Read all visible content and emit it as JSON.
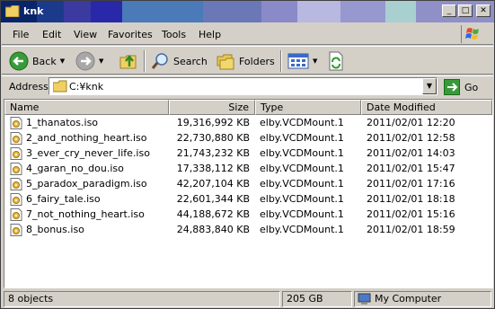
{
  "window": {
    "title": "knk"
  },
  "menu": [
    "File",
    "Edit",
    "View",
    "Favorites",
    "Tools",
    "Help"
  ],
  "toolbar": {
    "back": "Back",
    "search": "Search",
    "folders": "Folders"
  },
  "address": {
    "label": "Address",
    "value": "C:¥knk",
    "go": "Go"
  },
  "columns": {
    "name": "Name",
    "size": "Size",
    "type": "Type",
    "modified": "Date Modified"
  },
  "files": [
    {
      "name": "1_thanatos.iso",
      "size": "19,316,992 KB",
      "type": "elby.VCDMount.1",
      "modified": "2011/02/01 12:20"
    },
    {
      "name": "2_and_nothing_heart.iso",
      "size": "22,730,880 KB",
      "type": "elby.VCDMount.1",
      "modified": "2011/02/01 12:58"
    },
    {
      "name": "3_ever_cry_never_life.iso",
      "size": "21,743,232 KB",
      "type": "elby.VCDMount.1",
      "modified": "2011/02/01 14:03"
    },
    {
      "name": "4_garan_no_dou.iso",
      "size": "17,338,112 KB",
      "type": "elby.VCDMount.1",
      "modified": "2011/02/01 15:47"
    },
    {
      "name": "5_paradox_paradigm.iso",
      "size": "42,207,104 KB",
      "type": "elby.VCDMount.1",
      "modified": "2011/02/01 17:16"
    },
    {
      "name": "6_fairy_tale.iso",
      "size": "22,601,344 KB",
      "type": "elby.VCDMount.1",
      "modified": "2011/02/01 18:18"
    },
    {
      "name": "7_not_nothing_heart.iso",
      "size": "44,188,672 KB",
      "type": "elby.VCDMount.1",
      "modified": "2011/02/01 15:16"
    },
    {
      "name": "8_bonus.iso",
      "size": "24,883,840 KB",
      "type": "elby.VCDMount.1",
      "modified": "2011/02/01 18:59"
    }
  ],
  "status": {
    "objects": "8 objects",
    "size": "205 GB",
    "location": "My Computer"
  }
}
